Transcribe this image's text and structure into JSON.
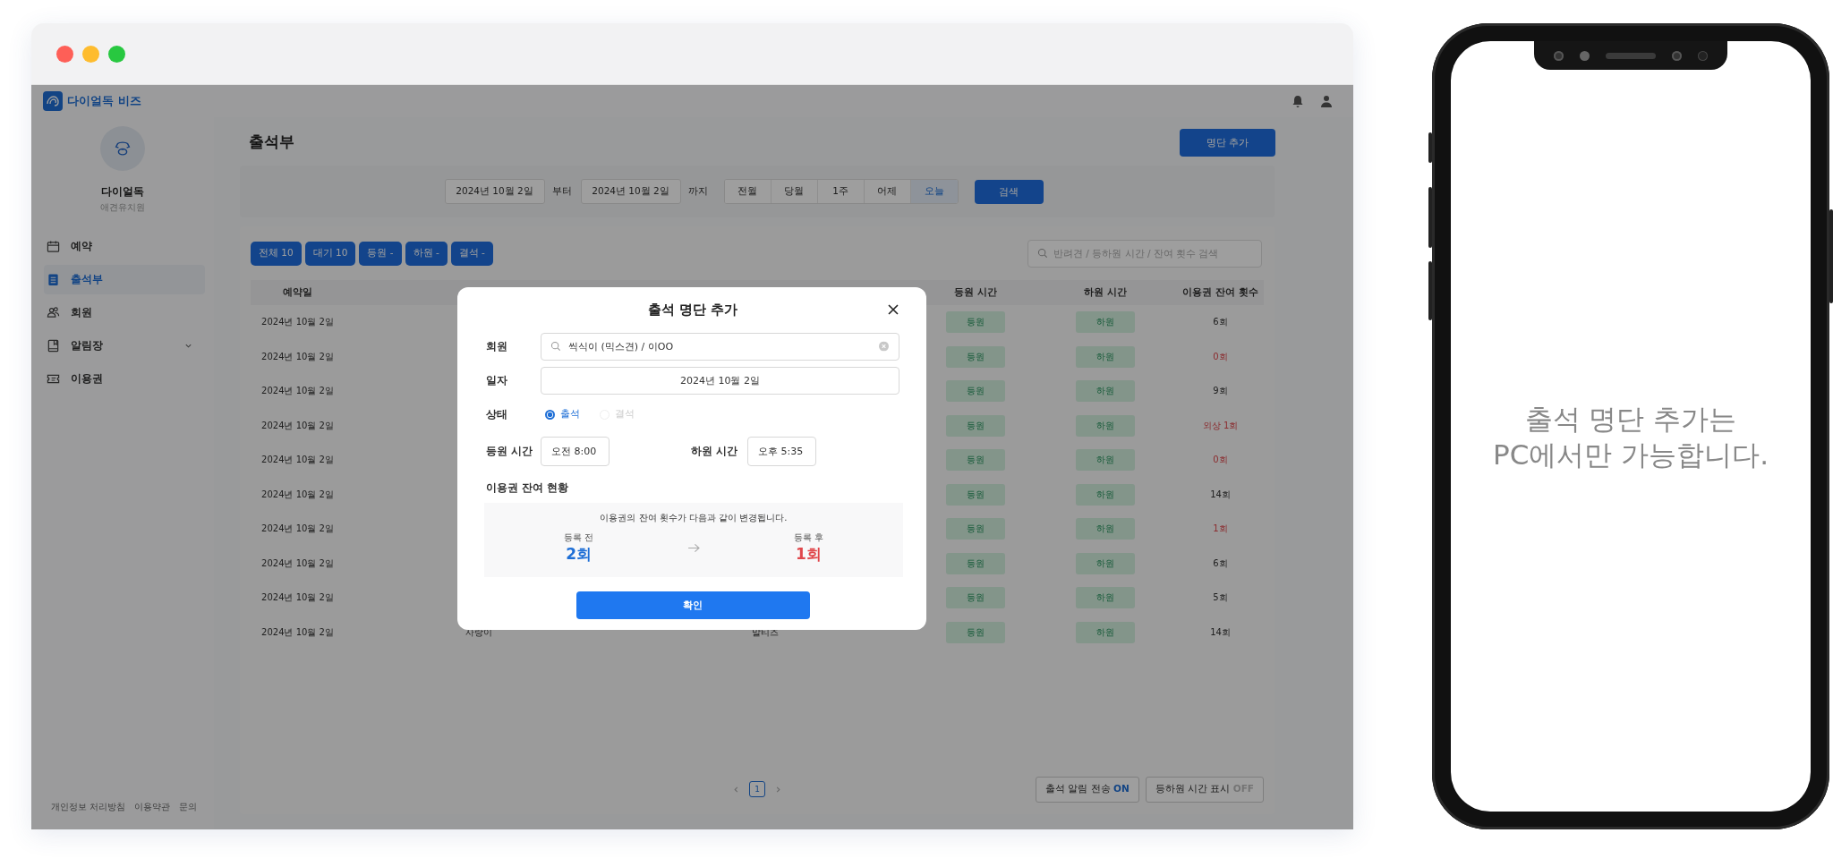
{
  "header": {
    "logo_text": "다이얼독 비즈"
  },
  "sidebar": {
    "profile": {
      "name": "다이얼독",
      "subtitle": "애견유치원"
    },
    "items": [
      {
        "label": "예약",
        "selected": false
      },
      {
        "label": "출석부",
        "selected": true
      },
      {
        "label": "회원",
        "selected": false
      },
      {
        "label": "알림장",
        "selected": false,
        "expanded": false
      },
      {
        "label": "이용권",
        "selected": false
      }
    ],
    "footer_links": [
      "개인정보 처리방침",
      "이용약관",
      "문의"
    ]
  },
  "page_title": "출석부",
  "add_button": "명단 추가",
  "date_filter": {
    "from": "2024년 10월 2일",
    "from_suffix": "부터",
    "to": "2024년 10월 2일",
    "to_suffix": "까지",
    "ranges": [
      {
        "label": "전월",
        "selected": false
      },
      {
        "label": "당월",
        "selected": false
      },
      {
        "label": "1주",
        "selected": false
      },
      {
        "label": "어제",
        "selected": false
      },
      {
        "label": "오늘",
        "selected": true
      }
    ],
    "search_button": "검색"
  },
  "status_chips": [
    "전체 10",
    "대기 10",
    "등원 -",
    "하원 -",
    "결석 -"
  ],
  "search": {
    "placeholder": "반려견 / 등하원 시간 / 잔여 횟수 검색"
  },
  "table": {
    "columns": [
      "예약일",
      "등원 시간",
      "하원 시간",
      "이용권 잔여 횟수"
    ],
    "rows": [
      {
        "date": "2024년 10월 2일",
        "checkin": "등원",
        "checkout": "하원",
        "remaining": "6회",
        "alert": false
      },
      {
        "date": "2024년 10월 2일",
        "checkin": "등원",
        "checkout": "하원",
        "remaining": "0회",
        "alert": true
      },
      {
        "date": "2024년 10월 2일",
        "checkin": "등원",
        "checkout": "하원",
        "remaining": "9회",
        "alert": false
      },
      {
        "date": "2024년 10월 2일",
        "checkin": "등원",
        "checkout": "하원",
        "remaining": "외상 1회",
        "alert": true
      },
      {
        "date": "2024년 10월 2일",
        "checkin": "등원",
        "checkout": "하원",
        "remaining": "0회",
        "alert": true
      },
      {
        "date": "2024년 10월 2일",
        "checkin": "등원",
        "checkout": "하원",
        "remaining": "14회",
        "alert": false
      },
      {
        "date": "2024년 10월 2일",
        "checkin": "등원",
        "checkout": "하원",
        "remaining": "1회",
        "alert": true
      },
      {
        "date": "2024년 10월 2일",
        "checkin": "등원",
        "checkout": "하원",
        "remaining": "6회",
        "alert": false
      },
      {
        "date": "2024년 10월 2일",
        "checkin": "등원",
        "checkout": "하원",
        "remaining": "5회",
        "alert": false
      },
      {
        "date": "2024년 10월 2일",
        "name": "사랑이",
        "breed": "말티즈",
        "checkin": "등원",
        "checkout": "하원",
        "remaining": "14회",
        "alert": false
      }
    ]
  },
  "pagination": {
    "pages": [
      {
        "label": "1",
        "selected": true
      }
    ]
  },
  "toggles": [
    {
      "label": "출석 알림 전송",
      "state": "ON",
      "on": true
    },
    {
      "label": "등하원 시간 표시",
      "state": "OFF",
      "on": false
    }
  ],
  "modal": {
    "title": "출석 명단 추가",
    "member": {
      "label": "회원",
      "value": "씩식이 (믹스견) / 이OO"
    },
    "date": {
      "label": "일자",
      "value": "2024년 10월 2일"
    },
    "status": {
      "label": "상태",
      "options": [
        {
          "label": "출석",
          "selected": true
        },
        {
          "label": "결석",
          "selected": false
        }
      ]
    },
    "checkin": {
      "label": "등원 시간",
      "value": "오전 8:00"
    },
    "checkout": {
      "label": "하원 시간",
      "value": "오후 5:35"
    },
    "summary": {
      "title": "이용권 잔여 현황",
      "message": "이용권의 잔여 횟수가 다음과 같이 변경됩니다.",
      "before": {
        "label": "등록 전",
        "value": "2회"
      },
      "after": {
        "label": "등록 후",
        "value": "1회"
      }
    },
    "confirm": "확인"
  },
  "phone": {
    "message": "출석 명단 추가는\nPC에서만 가능합니다."
  }
}
